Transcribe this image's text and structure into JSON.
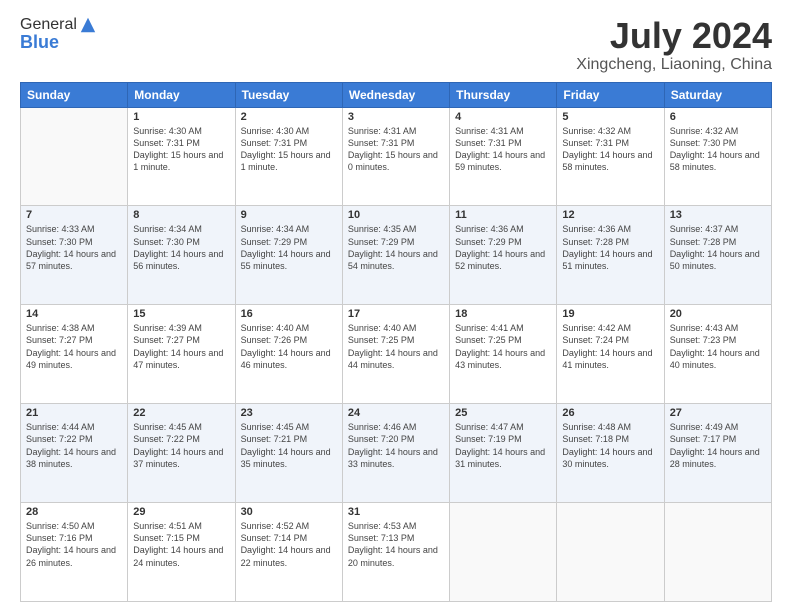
{
  "logo": {
    "general": "General",
    "blue": "Blue"
  },
  "header": {
    "title": "July 2024",
    "subtitle": "Xingcheng, Liaoning, China"
  },
  "days": [
    "Sunday",
    "Monday",
    "Tuesday",
    "Wednesday",
    "Thursday",
    "Friday",
    "Saturday"
  ],
  "weeks": [
    [
      {
        "num": "",
        "sunrise": "",
        "sunset": "",
        "daylight": ""
      },
      {
        "num": "1",
        "sunrise": "Sunrise: 4:30 AM",
        "sunset": "Sunset: 7:31 PM",
        "daylight": "Daylight: 15 hours and 1 minute."
      },
      {
        "num": "2",
        "sunrise": "Sunrise: 4:30 AM",
        "sunset": "Sunset: 7:31 PM",
        "daylight": "Daylight: 15 hours and 1 minute."
      },
      {
        "num": "3",
        "sunrise": "Sunrise: 4:31 AM",
        "sunset": "Sunset: 7:31 PM",
        "daylight": "Daylight: 15 hours and 0 minutes."
      },
      {
        "num": "4",
        "sunrise": "Sunrise: 4:31 AM",
        "sunset": "Sunset: 7:31 PM",
        "daylight": "Daylight: 14 hours and 59 minutes."
      },
      {
        "num": "5",
        "sunrise": "Sunrise: 4:32 AM",
        "sunset": "Sunset: 7:31 PM",
        "daylight": "Daylight: 14 hours and 58 minutes."
      },
      {
        "num": "6",
        "sunrise": "Sunrise: 4:32 AM",
        "sunset": "Sunset: 7:30 PM",
        "daylight": "Daylight: 14 hours and 58 minutes."
      }
    ],
    [
      {
        "num": "7",
        "sunrise": "Sunrise: 4:33 AM",
        "sunset": "Sunset: 7:30 PM",
        "daylight": "Daylight: 14 hours and 57 minutes."
      },
      {
        "num": "8",
        "sunrise": "Sunrise: 4:34 AM",
        "sunset": "Sunset: 7:30 PM",
        "daylight": "Daylight: 14 hours and 56 minutes."
      },
      {
        "num": "9",
        "sunrise": "Sunrise: 4:34 AM",
        "sunset": "Sunset: 7:29 PM",
        "daylight": "Daylight: 14 hours and 55 minutes."
      },
      {
        "num": "10",
        "sunrise": "Sunrise: 4:35 AM",
        "sunset": "Sunset: 7:29 PM",
        "daylight": "Daylight: 14 hours and 54 minutes."
      },
      {
        "num": "11",
        "sunrise": "Sunrise: 4:36 AM",
        "sunset": "Sunset: 7:29 PM",
        "daylight": "Daylight: 14 hours and 52 minutes."
      },
      {
        "num": "12",
        "sunrise": "Sunrise: 4:36 AM",
        "sunset": "Sunset: 7:28 PM",
        "daylight": "Daylight: 14 hours and 51 minutes."
      },
      {
        "num": "13",
        "sunrise": "Sunrise: 4:37 AM",
        "sunset": "Sunset: 7:28 PM",
        "daylight": "Daylight: 14 hours and 50 minutes."
      }
    ],
    [
      {
        "num": "14",
        "sunrise": "Sunrise: 4:38 AM",
        "sunset": "Sunset: 7:27 PM",
        "daylight": "Daylight: 14 hours and 49 minutes."
      },
      {
        "num": "15",
        "sunrise": "Sunrise: 4:39 AM",
        "sunset": "Sunset: 7:27 PM",
        "daylight": "Daylight: 14 hours and 47 minutes."
      },
      {
        "num": "16",
        "sunrise": "Sunrise: 4:40 AM",
        "sunset": "Sunset: 7:26 PM",
        "daylight": "Daylight: 14 hours and 46 minutes."
      },
      {
        "num": "17",
        "sunrise": "Sunrise: 4:40 AM",
        "sunset": "Sunset: 7:25 PM",
        "daylight": "Daylight: 14 hours and 44 minutes."
      },
      {
        "num": "18",
        "sunrise": "Sunrise: 4:41 AM",
        "sunset": "Sunset: 7:25 PM",
        "daylight": "Daylight: 14 hours and 43 minutes."
      },
      {
        "num": "19",
        "sunrise": "Sunrise: 4:42 AM",
        "sunset": "Sunset: 7:24 PM",
        "daylight": "Daylight: 14 hours and 41 minutes."
      },
      {
        "num": "20",
        "sunrise": "Sunrise: 4:43 AM",
        "sunset": "Sunset: 7:23 PM",
        "daylight": "Daylight: 14 hours and 40 minutes."
      }
    ],
    [
      {
        "num": "21",
        "sunrise": "Sunrise: 4:44 AM",
        "sunset": "Sunset: 7:22 PM",
        "daylight": "Daylight: 14 hours and 38 minutes."
      },
      {
        "num": "22",
        "sunrise": "Sunrise: 4:45 AM",
        "sunset": "Sunset: 7:22 PM",
        "daylight": "Daylight: 14 hours and 37 minutes."
      },
      {
        "num": "23",
        "sunrise": "Sunrise: 4:45 AM",
        "sunset": "Sunset: 7:21 PM",
        "daylight": "Daylight: 14 hours and 35 minutes."
      },
      {
        "num": "24",
        "sunrise": "Sunrise: 4:46 AM",
        "sunset": "Sunset: 7:20 PM",
        "daylight": "Daylight: 14 hours and 33 minutes."
      },
      {
        "num": "25",
        "sunrise": "Sunrise: 4:47 AM",
        "sunset": "Sunset: 7:19 PM",
        "daylight": "Daylight: 14 hours and 31 minutes."
      },
      {
        "num": "26",
        "sunrise": "Sunrise: 4:48 AM",
        "sunset": "Sunset: 7:18 PM",
        "daylight": "Daylight: 14 hours and 30 minutes."
      },
      {
        "num": "27",
        "sunrise": "Sunrise: 4:49 AM",
        "sunset": "Sunset: 7:17 PM",
        "daylight": "Daylight: 14 hours and 28 minutes."
      }
    ],
    [
      {
        "num": "28",
        "sunrise": "Sunrise: 4:50 AM",
        "sunset": "Sunset: 7:16 PM",
        "daylight": "Daylight: 14 hours and 26 minutes."
      },
      {
        "num": "29",
        "sunrise": "Sunrise: 4:51 AM",
        "sunset": "Sunset: 7:15 PM",
        "daylight": "Daylight: 14 hours and 24 minutes."
      },
      {
        "num": "30",
        "sunrise": "Sunrise: 4:52 AM",
        "sunset": "Sunset: 7:14 PM",
        "daylight": "Daylight: 14 hours and 22 minutes."
      },
      {
        "num": "31",
        "sunrise": "Sunrise: 4:53 AM",
        "sunset": "Sunset: 7:13 PM",
        "daylight": "Daylight: 14 hours and 20 minutes."
      },
      {
        "num": "",
        "sunrise": "",
        "sunset": "",
        "daylight": ""
      },
      {
        "num": "",
        "sunrise": "",
        "sunset": "",
        "daylight": ""
      },
      {
        "num": "",
        "sunrise": "",
        "sunset": "",
        "daylight": ""
      }
    ]
  ]
}
